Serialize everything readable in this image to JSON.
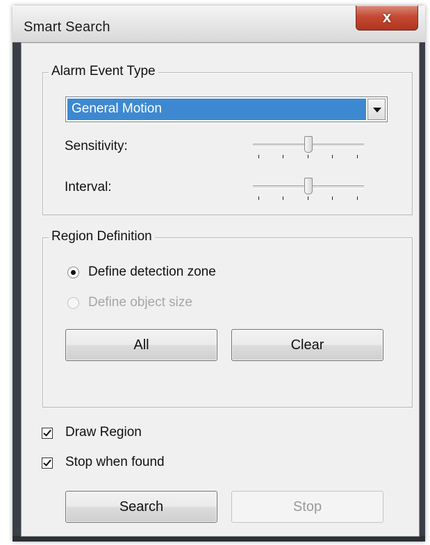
{
  "window": {
    "title": "Smart Search",
    "close_glyph": "x"
  },
  "alarm_event": {
    "group_title": "Alarm Event Type",
    "event_type_selected": "General Motion",
    "sensitivity_label": "Sensitivity:",
    "sensitivity_level": 0.5,
    "interval_label": "Interval:",
    "interval_level": 0.5
  },
  "region": {
    "group_title": "Region Definition",
    "option_zone_label": "Define detection zone",
    "option_zone_selected": true,
    "option_size_label": "Define object size",
    "option_size_enabled": false,
    "all_button": "All",
    "clear_button": "Clear"
  },
  "options": {
    "draw_region_label": "Draw Region",
    "draw_region_checked": true,
    "stop_when_found_label": "Stop when found",
    "stop_when_found_checked": true
  },
  "actions": {
    "search_button": "Search",
    "stop_button": "Stop",
    "stop_enabled": false
  },
  "colors": {
    "selection": "#3d89d1",
    "close_button": "#c44a33",
    "dialog_bg": "#f0f0f0"
  }
}
